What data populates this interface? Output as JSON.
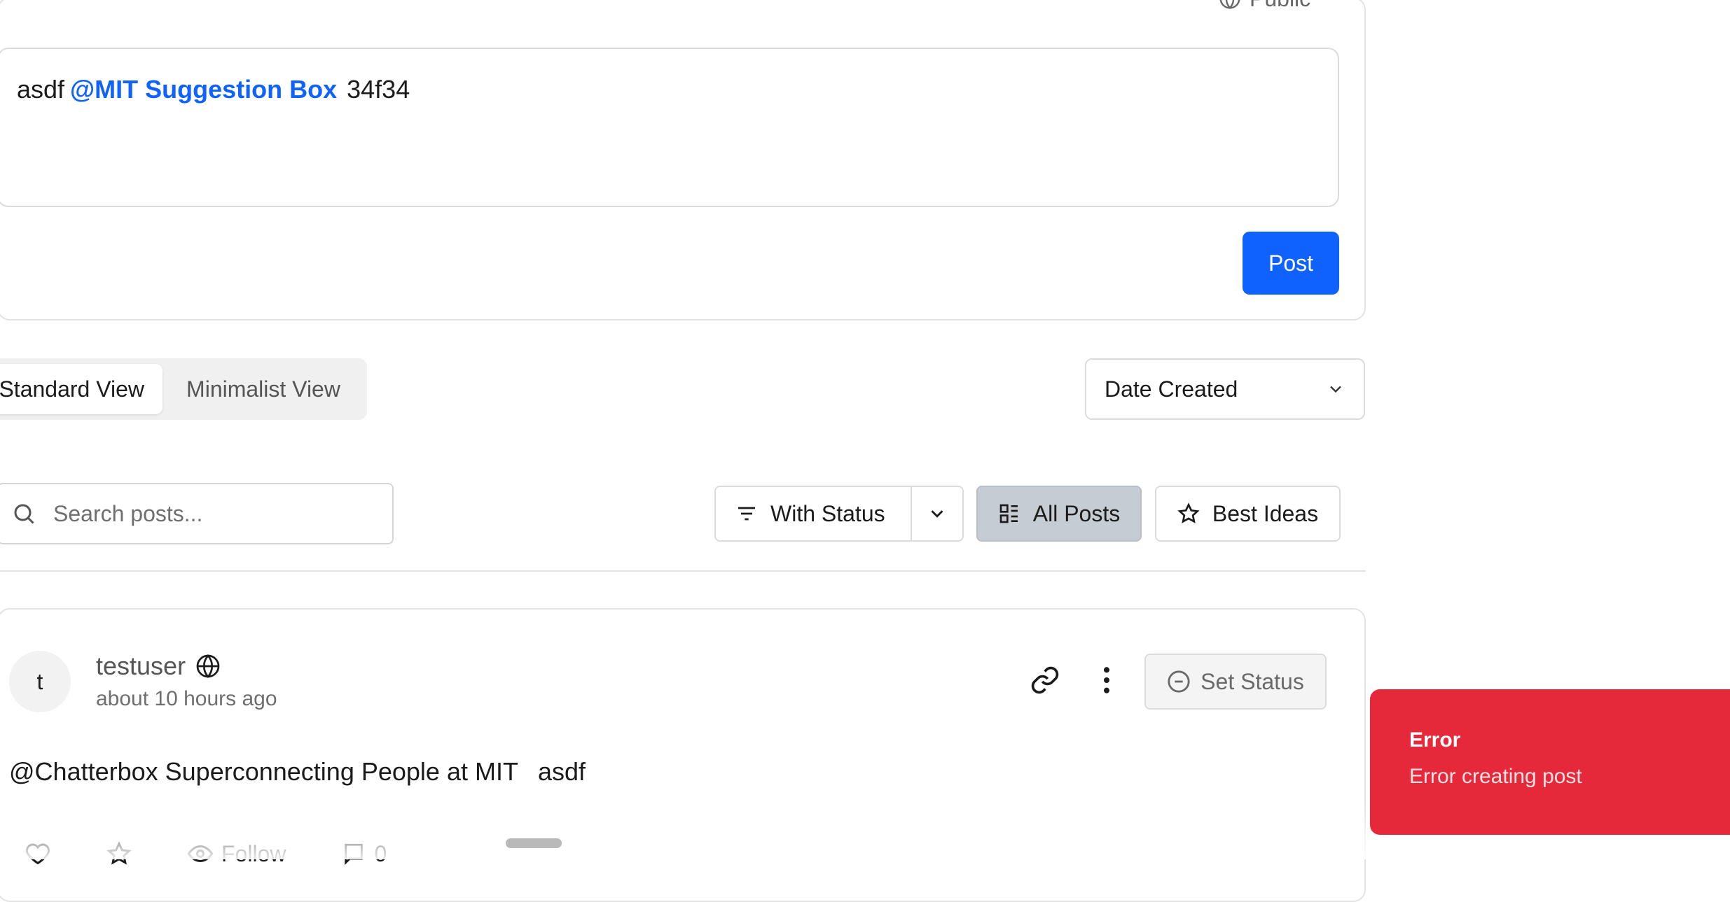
{
  "composer": {
    "visibility_label": "Public",
    "text_before": "asdf",
    "mention": "@MIT Suggestion Box",
    "text_after": "34f34",
    "post_button": "Post"
  },
  "view_toggle": {
    "standard": "Standard View",
    "minimalist": "Minimalist View",
    "selected": "Standard View"
  },
  "sort": {
    "selected": "Date Created"
  },
  "search": {
    "placeholder": "Search posts..."
  },
  "filters": {
    "with_status": "With Status",
    "all_posts": "All Posts",
    "best_ideas": "Best Ideas",
    "active": "All Posts"
  },
  "post": {
    "avatar_initial": "t",
    "author": "testuser",
    "timestamp": "about 10 hours ago",
    "set_status": "Set Status",
    "body_mention": "@Chatterbox Superconnecting People at MIT",
    "body_text": "asdf",
    "actions": {
      "follow": "Follow",
      "comment_count": "0"
    }
  },
  "toast": {
    "title": "Error",
    "message": "Error creating post"
  },
  "colors": {
    "primary": "#0f62fe",
    "error": "#e5283a",
    "active_filter": "#c6ccd3"
  }
}
